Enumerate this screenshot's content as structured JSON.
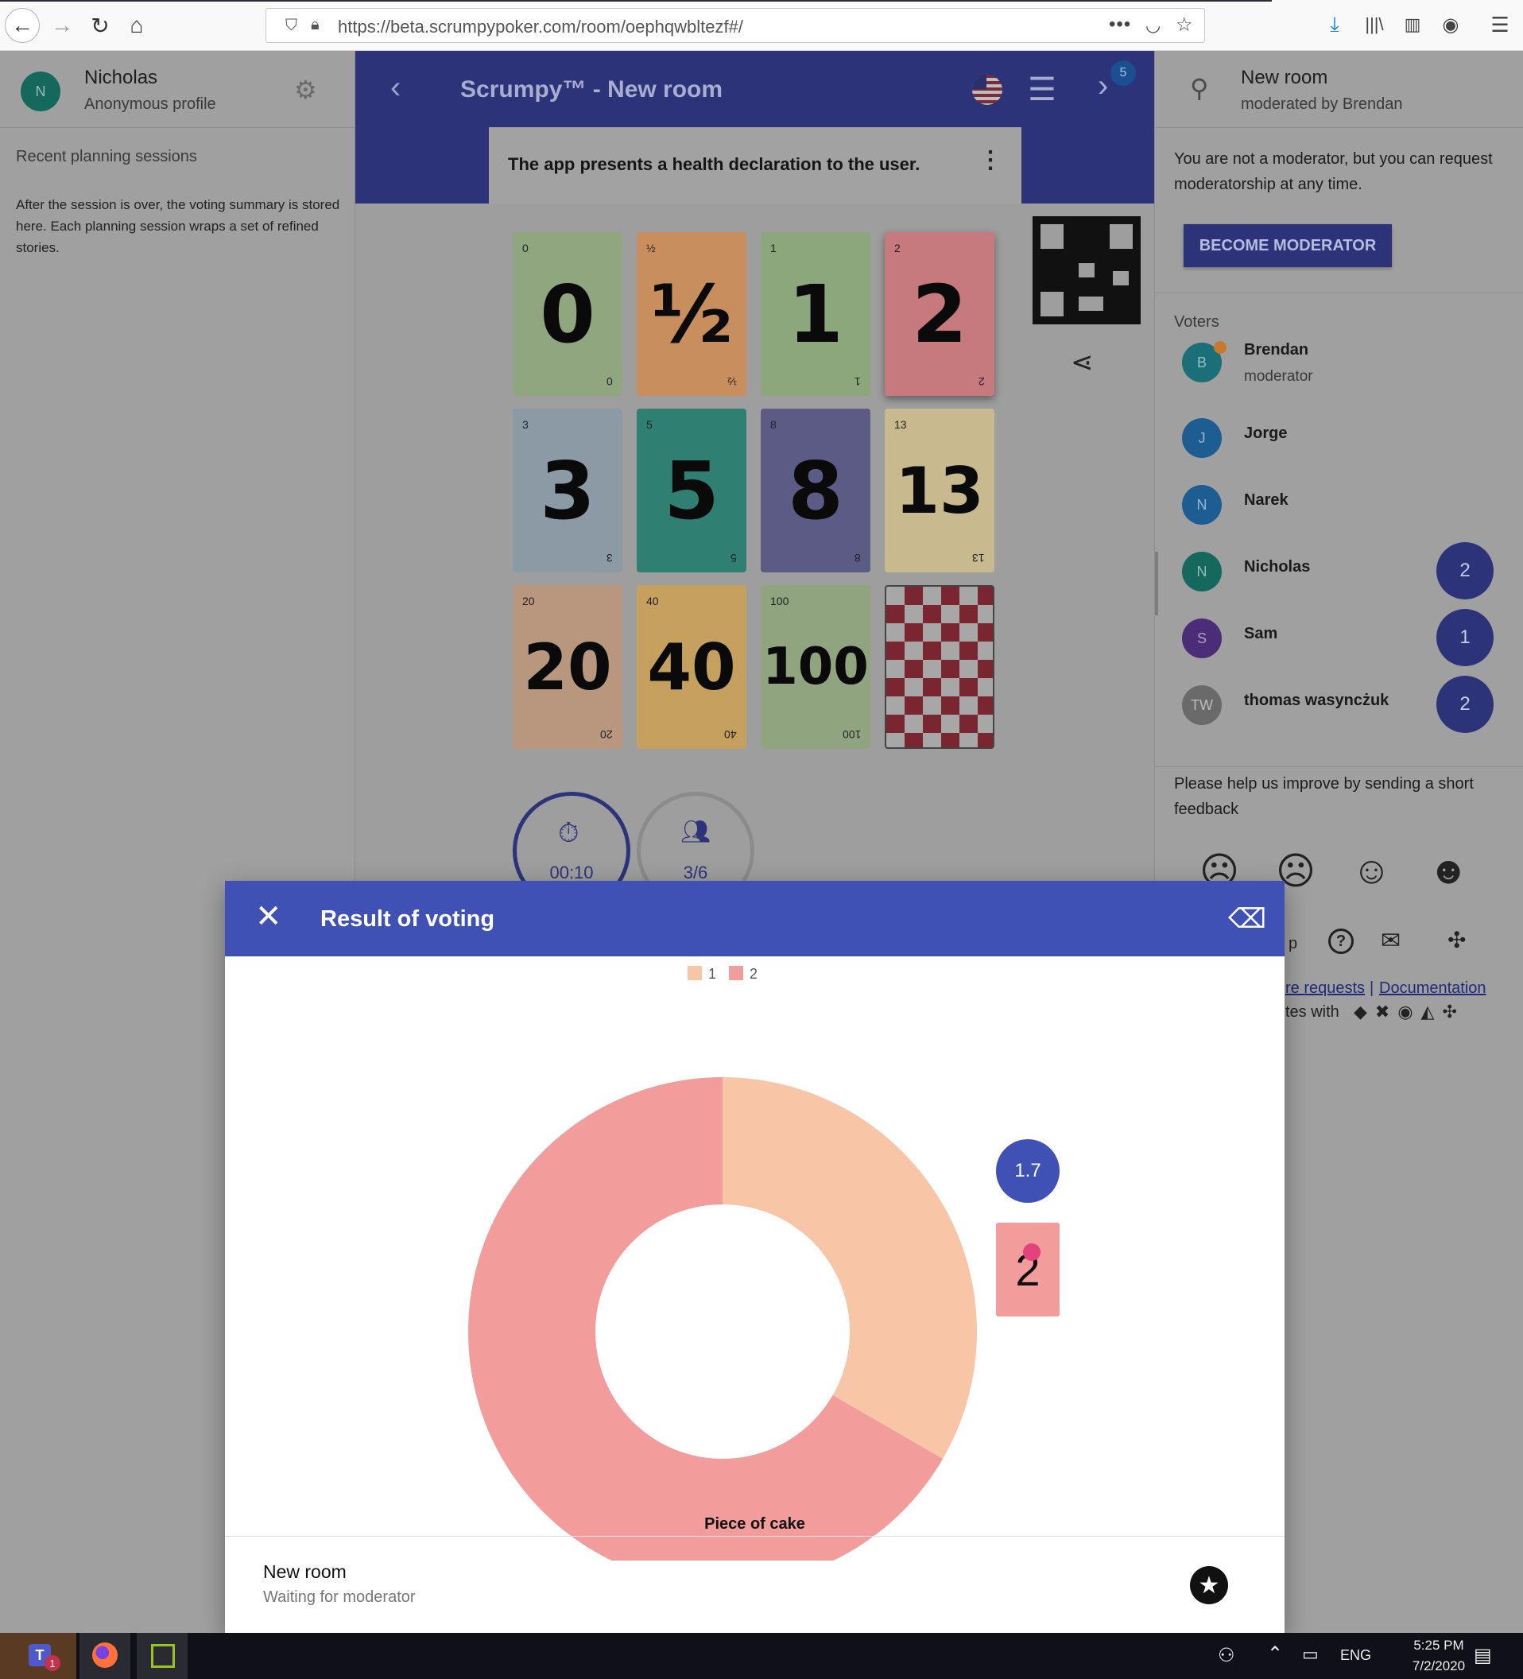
{
  "browser": {
    "url": "https://beta.scrumpypoker.com/room/oephqwbltezf#/"
  },
  "left": {
    "user_initial": "N",
    "user_name": "Nicholas",
    "user_profile": "Anonymous profile",
    "recent_title": "Recent planning sessions",
    "recent_text": "After the session is over, the voting summary is stored here. Each planning session wraps a set of refined stories."
  },
  "header": {
    "title": "Scrumpy™ - New room",
    "badge_count": "5",
    "story": "The app presents a health declaration to the user."
  },
  "cards": [
    {
      "value": "0",
      "bg": "#8fa67f"
    },
    {
      "value": "½",
      "bg": "#c88e5e"
    },
    {
      "value": "1",
      "bg": "#8da77c"
    },
    {
      "value": "2",
      "bg": "#c77a7d"
    },
    {
      "value": "3",
      "bg": "#8b9aa5"
    },
    {
      "value": "5",
      "bg": "#2f7f72"
    },
    {
      "value": "8",
      "bg": "#5c5b86"
    },
    {
      "value": "13",
      "bg": "#c9b98e"
    },
    {
      "value": "20",
      "bg": "#b9977e"
    },
    {
      "value": "40",
      "bg": "#c5a05e"
    },
    {
      "value": "100",
      "bg": "#90a57f"
    }
  ],
  "timer": {
    "time": "00:10",
    "participants": "3/6"
  },
  "right": {
    "room_name": "New room",
    "moderated_by": "moderated by Brendan",
    "not_moderator_text": "You are not a moderator, but you can request moderatorship at any time.",
    "become_moderator": "BECOME MODERATOR",
    "voters_title": "Voters",
    "voters": [
      {
        "initial": "B",
        "name": "Brendan",
        "sub": "moderator",
        "vote": "",
        "color": "#1a6f78"
      },
      {
        "initial": "J",
        "name": "Jorge",
        "sub": "",
        "vote": "",
        "color": "#1d5d92"
      },
      {
        "initial": "N",
        "name": "Narek",
        "sub": "",
        "vote": "",
        "color": "#1d5d92"
      },
      {
        "initial": "N",
        "name": "Nicholas",
        "sub": "",
        "vote": "2",
        "color": "#14685c"
      },
      {
        "initial": "S",
        "name": "Sam",
        "sub": "",
        "vote": "1",
        "color": "#4b2c76"
      },
      {
        "initial": "TW",
        "name": "thomas wasyncżuk",
        "sub": "",
        "vote": "2",
        "color": "#6a6a6a"
      }
    ],
    "feedback_text": "Please help us improve by sending a short feedback",
    "link_p": "p",
    "link_feature": "re requests",
    "link_sep": "|",
    "link_docs": "Documentation",
    "integrates": "tes with"
  },
  "modal": {
    "title": "Result of voting",
    "average": "1.7",
    "card_label": "Piece of cake",
    "footer_title": "New room",
    "footer_sub": "Waiting for moderator"
  },
  "chart_data": {
    "type": "pie",
    "categories": [
      "1",
      "2"
    ],
    "values": [
      1,
      2
    ],
    "colors": [
      "#f8c6a6",
      "#f29c9c"
    ],
    "legend": "top",
    "title": ""
  },
  "taskbar": {
    "lang": "ENG",
    "time": "5:25 PM",
    "date": "7/2/2020",
    "teams_badge": "1"
  }
}
